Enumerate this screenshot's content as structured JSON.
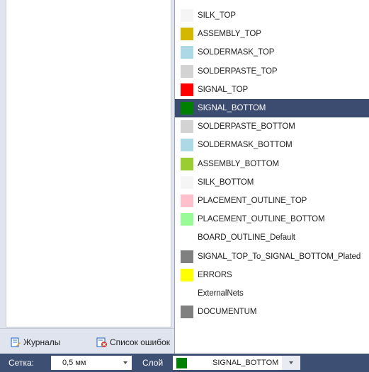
{
  "tabs": {
    "journals_label": "Журналы",
    "errors_label": "Список ошибок"
  },
  "status_bar": {
    "grid_label": "Сетка:",
    "grid_value": "0,5 мм",
    "layer_label": "Слой",
    "layer_value": "SIGNAL_BOTTOM",
    "layer_color": "#008000"
  },
  "layers": {
    "selected_index": 5,
    "items": [
      {
        "name": "SILK_TOP",
        "color": "#f5f5f5"
      },
      {
        "name": "ASSEMBLY_TOP",
        "color": "#d4b800"
      },
      {
        "name": "SOLDERMASK_TOP",
        "color": "#add8e6"
      },
      {
        "name": "SOLDERPASTE_TOP",
        "color": "#d3d3d3"
      },
      {
        "name": "SIGNAL_TOP",
        "color": "#ff0000"
      },
      {
        "name": "SIGNAL_BOTTOM",
        "color": "#008000"
      },
      {
        "name": "SOLDERPASTE_BOTTOM",
        "color": "#d3d3d3"
      },
      {
        "name": "SOLDERMASK_BOTTOM",
        "color": "#add8e6"
      },
      {
        "name": "ASSEMBLY_BOTTOM",
        "color": "#9acd32"
      },
      {
        "name": "SILK_BOTTOM",
        "color": "#f5f5f5"
      },
      {
        "name": "PLACEMENT_OUTLINE_TOP",
        "color": "#ffc0cb"
      },
      {
        "name": "PLACEMENT_OUTLINE_BOTTOM",
        "color": "#98fb98"
      },
      {
        "name": "BOARD_OUTLINE_Default",
        "color": "#ffffff"
      },
      {
        "name": "SIGNAL_TOP_To_SIGNAL_BOTTOM_Plated",
        "color": "#808080"
      },
      {
        "name": "ERRORS",
        "color": "#ffff00"
      },
      {
        "name": "ExternalNets",
        "color": "#ffffff"
      },
      {
        "name": "DOCUMENTUM",
        "color": "#808080"
      }
    ]
  }
}
